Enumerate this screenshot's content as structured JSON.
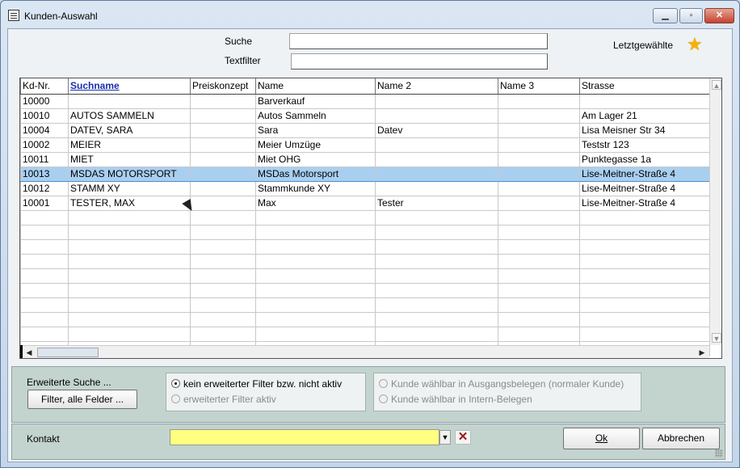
{
  "window": {
    "title": "Kunden-Auswahl",
    "minimize_glyph": "▁",
    "maximize_glyph": "▫",
    "close_glyph": "✕"
  },
  "search": {
    "suche_label": "Suche",
    "suche_value": "",
    "textfilter_label": "Textfilter",
    "textfilter_value": "",
    "recent_label": "Letztgewählte",
    "recent_icon": "star-icon"
  },
  "grid": {
    "columns": [
      "Kd-Nr.",
      "Suchname",
      "Preiskonzept",
      "Name",
      "Name 2",
      "Name 3",
      "Strasse"
    ],
    "sorted_column": "Suchname",
    "rows": [
      [
        "10000",
        "",
        "",
        "Barverkauf",
        "",
        "",
        ""
      ],
      [
        "10010",
        "AUTOS SAMMELN",
        "",
        "Autos Sammeln",
        "",
        "",
        "Am Lager 21"
      ],
      [
        "10004",
        "DATEV, SARA",
        "",
        "Sara",
        "Datev",
        "",
        "Lisa Meisner Str 34"
      ],
      [
        "10002",
        "MEIER",
        "",
        "Meier Umzüge",
        "",
        "",
        "Teststr 123"
      ],
      [
        "10011",
        "MIET",
        "",
        "Miet OHG",
        "",
        "",
        "Punktegasse 1a"
      ],
      [
        "10013",
        "MSDAS MOTORSPORT",
        "",
        "MSDas Motorsport",
        "",
        "",
        "Lise-Meitner-Straße 4"
      ],
      [
        "10012",
        "STAMM XY",
        "",
        "Stammkunde XY",
        "",
        "",
        "Lise-Meitner-Straße 4"
      ],
      [
        "10001",
        "TESTER, MAX",
        "",
        "Max",
        "Tester",
        "",
        "Lise-Meitner-Straße 4"
      ]
    ],
    "selected_row_index": 5,
    "empty_rows": 10,
    "scroll_up": "▲",
    "scroll_down": "▼",
    "scroll_left": "◀",
    "scroll_right": "▶"
  },
  "extended": {
    "label": "Erweiterte Suche ...",
    "button": "Filter, alle Felder ...",
    "filter_off": "kein erweiterter Filter bzw. nicht aktiv",
    "filter_on": "erweiterter Filter aktiv",
    "kunde_ausgang": "Kunde wählbar in Ausgangsbelegen (normaler Kunde)",
    "kunde_intern": "Kunde wählbar in Intern-Belegen"
  },
  "bottom": {
    "kontakt_label": "Kontakt",
    "kontakt_value": "",
    "combo_arrow": "▼",
    "clear_glyph": "✕",
    "ok_label": "Ok",
    "cancel_label": "Abbrechen"
  },
  "colors": {
    "selected_row": "#a9cff0",
    "panel": "#c3d4cf",
    "kontakt_field": "#ffff80",
    "sorted_header": "#1a2eae"
  }
}
